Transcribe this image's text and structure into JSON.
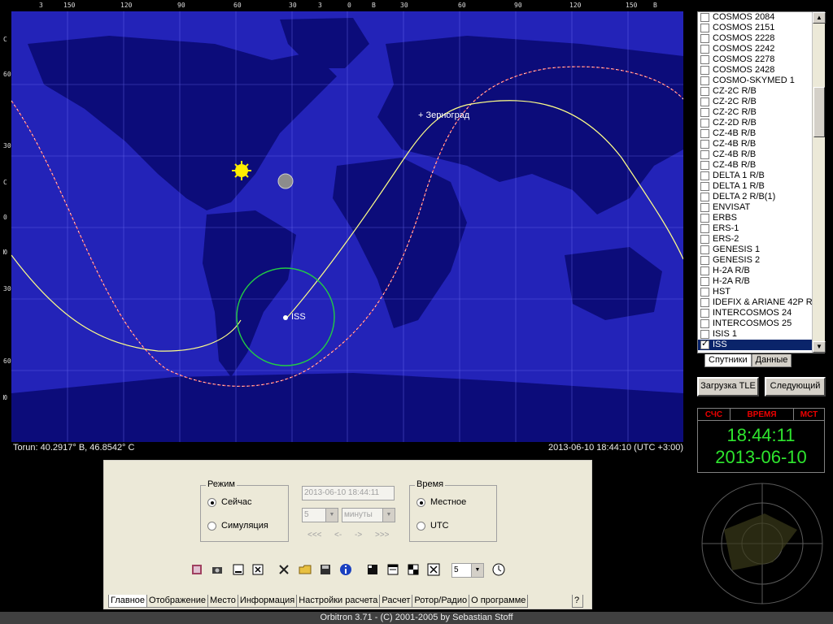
{
  "ruler": {
    "top": [
      "З",
      "150",
      "120",
      "90",
      "60",
      "30",
      "З",
      "0",
      "В",
      "30",
      "60",
      "90",
      "120",
      "150",
      "В"
    ],
    "left": [
      "С",
      "60",
      "30",
      "С",
      "0",
      "Ю",
      "30",
      "60",
      "Ю"
    ]
  },
  "map": {
    "city_label": "+ Зерноград",
    "iss_label": "ISS"
  },
  "status": {
    "location": "Torun: 40.2917° В, 46.8542° С",
    "datetime": "2013-06-10 18:44:10 (UTC +3:00)"
  },
  "satellites": [
    {
      "name": "COSMOS 2084",
      "checked": false
    },
    {
      "name": "COSMOS 2151",
      "checked": false
    },
    {
      "name": "COSMOS 2228",
      "checked": false
    },
    {
      "name": "COSMOS 2242",
      "checked": false
    },
    {
      "name": "COSMOS 2278",
      "checked": false
    },
    {
      "name": "COSMOS 2428",
      "checked": false
    },
    {
      "name": "COSMO-SKYMED 1",
      "checked": false
    },
    {
      "name": "CZ-2C R/B",
      "checked": false
    },
    {
      "name": "CZ-2C R/B",
      "checked": false
    },
    {
      "name": "CZ-2C R/B",
      "checked": false
    },
    {
      "name": "CZ-2D R/B",
      "checked": false
    },
    {
      "name": "CZ-4B R/B",
      "checked": false
    },
    {
      "name": "CZ-4B R/B",
      "checked": false
    },
    {
      "name": "CZ-4B R/B",
      "checked": false
    },
    {
      "name": "CZ-4B R/B",
      "checked": false
    },
    {
      "name": "DELTA 1 R/B",
      "checked": false
    },
    {
      "name": "DELTA 1 R/B",
      "checked": false
    },
    {
      "name": "DELTA 2 R/B(1)",
      "checked": false
    },
    {
      "name": "ENVISAT",
      "checked": false
    },
    {
      "name": "ERBS",
      "checked": false
    },
    {
      "name": "ERS-1",
      "checked": false
    },
    {
      "name": "ERS-2",
      "checked": false
    },
    {
      "name": "GENESIS 1",
      "checked": false
    },
    {
      "name": "GENESIS 2",
      "checked": false
    },
    {
      "name": "H-2A R/B",
      "checked": false
    },
    {
      "name": "H-2A R/B",
      "checked": false
    },
    {
      "name": "HST",
      "checked": false
    },
    {
      "name": "IDEFIX & ARIANE 42P R/",
      "checked": false
    },
    {
      "name": "INTERCOSMOS 24",
      "checked": false
    },
    {
      "name": "INTERCOSMOS 25",
      "checked": false
    },
    {
      "name": "ISIS 1",
      "checked": false
    },
    {
      "name": "ISS",
      "checked": true
    }
  ],
  "list_tabs": [
    "Спутники",
    "Данные"
  ],
  "buttons": {
    "load_tle": "Загрузка TLE",
    "next": "Следующий"
  },
  "clock": {
    "h1": "СЧС",
    "h2": "ВРЕМЯ",
    "h3": "МСТ",
    "time": "18:44:11",
    "date": "2013-06-10"
  },
  "mode": {
    "legend": "Режим",
    "now": "Сейчас",
    "sim": "Симуляция",
    "selected": "now"
  },
  "sim_controls": {
    "datetime": "2013-06-10 18:44:11",
    "step": "5",
    "unit": "минуты",
    "nav": [
      "<<<",
      "<-",
      "->",
      ">>>"
    ]
  },
  "time_mode": {
    "legend": "Время",
    "local": "Местное",
    "utc": "UTC",
    "selected": "local"
  },
  "toolbar": {
    "speed": "5"
  },
  "tabs": [
    "Главное",
    "Отображение",
    "Место",
    "Информация",
    "Настройки расчета",
    "Расчет",
    "Ротор/Радио",
    "О программе"
  ],
  "help": "?",
  "footer": "Orbitron 3.71 - (C) 2001-2005 by Sebastian Stoff",
  "colors": {
    "ocean": "#2323b8",
    "land": "#0c0c7a",
    "track": "#ffff88",
    "footprint": "#22cc44",
    "terminator": "#ff5555",
    "clock_green": "#2ee52e"
  }
}
